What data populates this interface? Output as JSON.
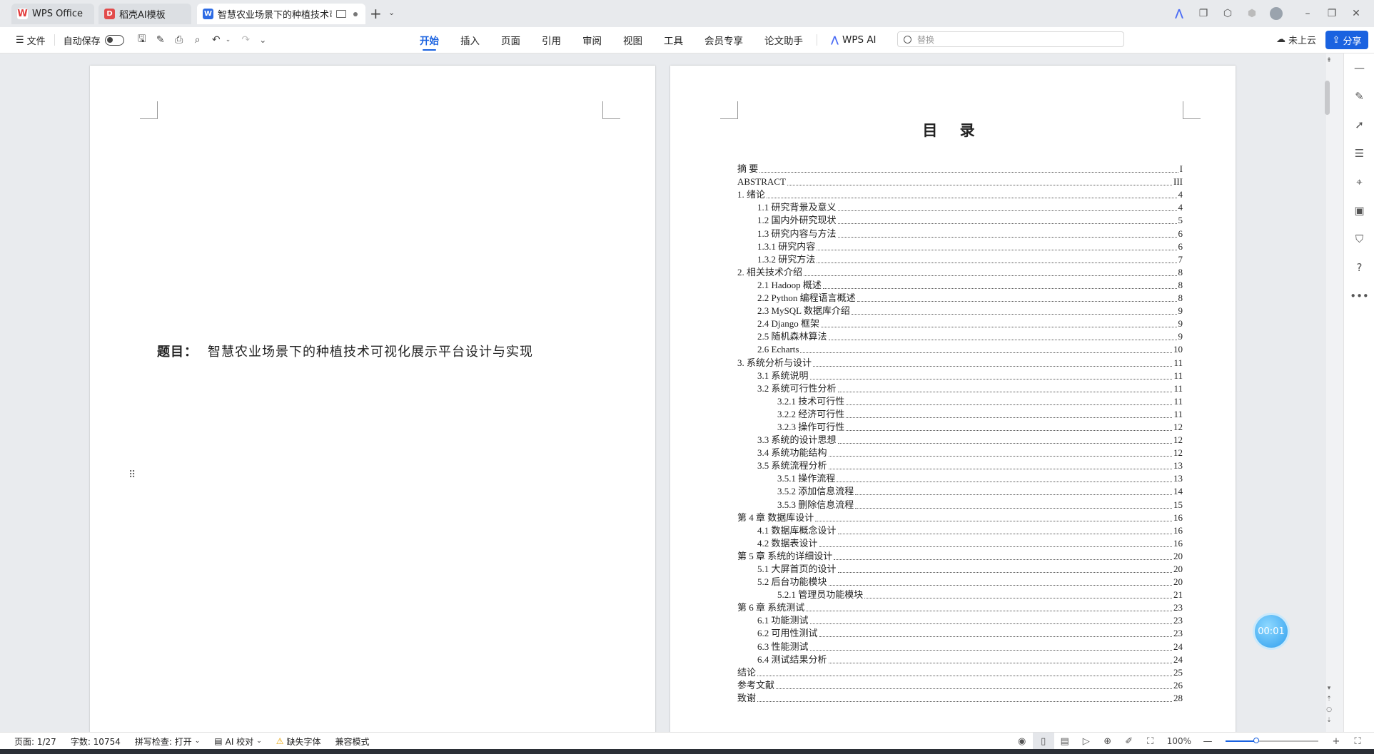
{
  "tabs": [
    {
      "label": "WPS Office",
      "logo": "W",
      "logo_color": "#e33d3d",
      "active": false
    },
    {
      "label": "稻壳AI模板",
      "logo": "D",
      "logo_color": "#e24b4b",
      "active": false
    },
    {
      "label": "智慧农业场景下的种植技术可",
      "logo": "W",
      "logo_color": "#2d6be4",
      "active": true
    }
  ],
  "toolbar": {
    "file_label": "文件",
    "autosave_label": "自动保存",
    "menu": [
      "开始",
      "插入",
      "页面",
      "引用",
      "审阅",
      "视图",
      "工具",
      "会员专享",
      "论文助手",
      "WPS AI"
    ],
    "active_menu": "开始",
    "search_placeholder": "替换",
    "cloud_label": "未上云",
    "share_label": "分享"
  },
  "left_page": {
    "title_label": "题目：",
    "title_text": "智慧农业场景下的种植技术可视化展示平台设计与实现"
  },
  "toc": {
    "heading": "目  录",
    "entries": [
      {
        "text": "摘    要",
        "page": "I",
        "level": 1
      },
      {
        "text": "ABSTRACT",
        "page": "III",
        "level": 1
      },
      {
        "text": "1.  绪论",
        "page": "4",
        "level": 1
      },
      {
        "text": "1.1 研究背景及意义",
        "page": "4",
        "level": 2
      },
      {
        "text": "1.2 国内外研究现状",
        "page": "5",
        "level": 2
      },
      {
        "text": "1.3 研究内容与方法",
        "page": "6",
        "level": 2
      },
      {
        "text": "1.3.1 研究内容",
        "page": "6",
        "level": 2
      },
      {
        "text": "1.3.2 研究方法",
        "page": "7",
        "level": 2
      },
      {
        "text": "2.  相关技术介绍",
        "page": "8",
        "level": 1
      },
      {
        "text": "2.1 Hadoop 概述",
        "page": "8",
        "level": 2
      },
      {
        "text": "2.2 Python 编程语言概述",
        "page": "8",
        "level": 2
      },
      {
        "text": "2.3 MySQL 数据库介绍",
        "page": "9",
        "level": 2
      },
      {
        "text": "2.4 Django 框架",
        "page": "9",
        "level": 2
      },
      {
        "text": "2.5 随机森林算法",
        "page": "9",
        "level": 2
      },
      {
        "text": "2.6 Echarts",
        "page": "10",
        "level": 2
      },
      {
        "text": "3. 系统分析与设计",
        "page": "11",
        "level": 1
      },
      {
        "text": "3.1 系统说明",
        "page": "11",
        "level": 2
      },
      {
        "text": "3.2 系统可行性分析",
        "page": "11",
        "level": 2
      },
      {
        "text": "3.2.1 技术可行性",
        "page": "11",
        "level": 3
      },
      {
        "text": "3.2.2 经济可行性",
        "page": "11",
        "level": 3
      },
      {
        "text": "3.2.3 操作可行性",
        "page": "12",
        "level": 3
      },
      {
        "text": "3.3 系统的设计思想",
        "page": "12",
        "level": 2
      },
      {
        "text": "3.4 系统功能结构",
        "page": "12",
        "level": 2
      },
      {
        "text": "3.5 系统流程分析",
        "page": "13",
        "level": 2
      },
      {
        "text": "3.5.1 操作流程",
        "page": "13",
        "level": 3
      },
      {
        "text": "3.5.2 添加信息流程",
        "page": "14",
        "level": 3
      },
      {
        "text": "3.5.3 删除信息流程",
        "page": "15",
        "level": 3
      },
      {
        "text": "第 4 章 数据库设计",
        "page": "16",
        "level": 1
      },
      {
        "text": "4.1 数据库概念设计",
        "page": "16",
        "level": 2
      },
      {
        "text": "4.2 数据表设计",
        "page": "16",
        "level": 2
      },
      {
        "text": "第 5 章 系统的详细设计",
        "page": "20",
        "level": 1
      },
      {
        "text": "5.1 大屏首页的设计",
        "page": "20",
        "level": 2
      },
      {
        "text": "5.2 后台功能模块",
        "page": "20",
        "level": 2
      },
      {
        "text": "5.2.1 管理员功能模块",
        "page": "21",
        "level": 3
      },
      {
        "text": "第 6 章 系统测试",
        "page": "23",
        "level": 1
      },
      {
        "text": "6.1 功能测试",
        "page": "23",
        "level": 2
      },
      {
        "text": "6.2 可用性测试",
        "page": "23",
        "level": 2
      },
      {
        "text": "6.3 性能测试",
        "page": "24",
        "level": 2
      },
      {
        "text": "6.4 测试结果分析",
        "page": "24",
        "level": 2
      },
      {
        "text": "结论",
        "page": "25",
        "level": 1
      },
      {
        "text": "参考文献",
        "page": "26",
        "level": 1
      },
      {
        "text": "致谢",
        "page": "28",
        "level": 1
      }
    ]
  },
  "timer": "00:01",
  "status": {
    "page": "页面: 1/27",
    "words": "字数: 10754",
    "spellcheck": "拼写检查: 打开",
    "ai_check": "AI 校对",
    "missing_font": "缺失字体",
    "compat": "兼容模式",
    "zoom": "100%",
    "zoom_fraction": 0.33
  },
  "colors": {
    "accent": "#1a62e0"
  }
}
